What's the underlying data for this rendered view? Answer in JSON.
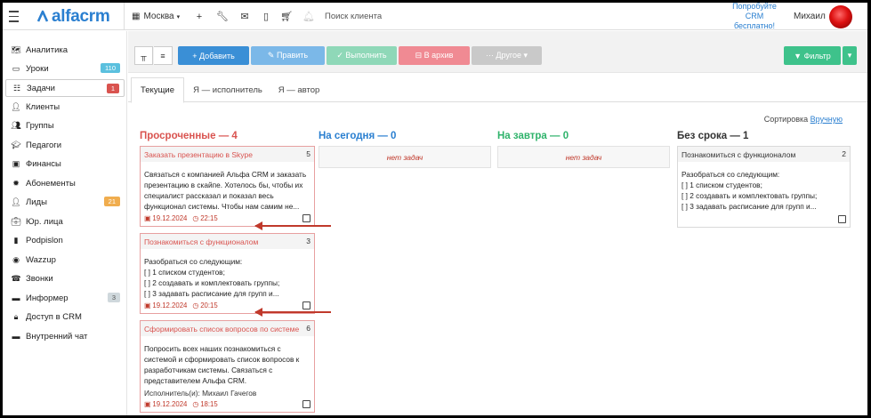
{
  "app": {
    "logo_text": "alfacrm"
  },
  "topbar": {
    "city": "Москва",
    "search_placeholder": "Поиск клиента",
    "promo": "Попробуйте CRM бесплатно!",
    "user_name": "Михаил"
  },
  "sidebar": {
    "items": [
      {
        "label": "Аналитика",
        "icon": "map-icon"
      },
      {
        "label": "Уроки",
        "icon": "calendar-icon",
        "badge": "110",
        "badge_color": "#5bc0de"
      },
      {
        "label": "Задачи",
        "icon": "tasks-icon",
        "badge": "1",
        "badge_color": "#d9534f"
      },
      {
        "label": "Клиенты",
        "icon": "user-icon"
      },
      {
        "label": "Группы",
        "icon": "users-icon"
      },
      {
        "label": "Педагоги",
        "icon": "graduation-cap-icon"
      },
      {
        "label": "Финансы",
        "icon": "money-icon"
      },
      {
        "label": "Абонементы",
        "icon": "badge-icon"
      },
      {
        "label": "Лиды",
        "icon": "leads-icon",
        "badge": "21",
        "badge_color": "#f0ad4e"
      },
      {
        "label": "Юр. лица",
        "icon": "briefcase-icon"
      },
      {
        "label": "Podpislon",
        "icon": "document-icon"
      },
      {
        "label": "Wazzup",
        "icon": "whatsapp-icon"
      },
      {
        "label": "Звонки",
        "icon": "phone-icon"
      },
      {
        "label": "Информер",
        "icon": "book-icon",
        "badge": "3",
        "badge_color": "#cfd8dc"
      },
      {
        "label": "Доступ в CRM",
        "icon": "lock-icon"
      },
      {
        "label": "Внутренний чат",
        "icon": "chat-icon"
      }
    ]
  },
  "toolbar": {
    "add": "+ Добавить",
    "edit": "✎ Править",
    "complete": "✓ Выполнить",
    "archive": "⊟ В архив",
    "other": "··· Другое ▾",
    "filter": "▼ Фильтр",
    "colors": {
      "add": "#3a8fd6",
      "edit": "#7bb8e8",
      "complete": "#8fd8b8",
      "archive": "#f08a93",
      "other": "#c9c9c9",
      "filter": "#3ec28b"
    }
  },
  "tabs": [
    "Текущие",
    "Я — исполнитель",
    "Я — автор"
  ],
  "sort": {
    "label": "Сортировка",
    "value": "Вручную"
  },
  "columns": [
    {
      "title": "Просроченные — 4",
      "color": "#d9534f"
    },
    {
      "title": "На сегодня — 0",
      "color": "#2a7fd0"
    },
    {
      "title": "На завтра — 0",
      "color": "#2fb36b"
    },
    {
      "title": "Без срока — 1",
      "color": "#333333"
    }
  ],
  "empty_text": "нет задач",
  "overdue_cards": [
    {
      "title": "Заказать презентацию в Skype",
      "num": "5",
      "text": "Связаться с компанией Альфа CRM и заказать презентацию в скайпе. Хотелось бы, чтобы их специалист рассказал и показал весь функционал системы. Чтобы нам самим не...",
      "date": "19.12.2024",
      "time": "22:15"
    },
    {
      "title": "Познакомиться с функционалом",
      "num": "3",
      "text": "Разобраться со следующим:\n[ ] 1 списком студентов;\n[ ] 2 создавать и комплектовать группы;\n[ ] 3 задавать расписание для групп и...",
      "date": "19.12.2024",
      "time": "20:15"
    },
    {
      "title": "Сформировать список вопросов по системе",
      "num": "6",
      "text": "Попросить всех наших познакомиться с системой и сформировать список вопросов к разработчикам системы. Связаться с представителем Альфа CRM.",
      "executor": "Исполнитель(и): Михаил Гачегов",
      "date": "19.12.2024",
      "time": "18:15"
    }
  ],
  "nodate_card": {
    "title": "Познакомиться с функционалом",
    "num": "2",
    "text": "Разобраться со следующим:\n[ ] 1 списком студентов;\n[ ] 2 создавать и комплектовать группы;\n[ ] 3 задавать расписание для групп и..."
  }
}
